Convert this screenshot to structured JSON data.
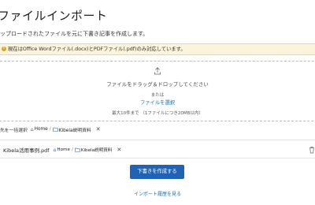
{
  "header": {
    "title": "ファイルインポート",
    "subtitle": "ップロードされたファイルを元に下書き記事を作成します。"
  },
  "notice": {
    "icon": "info-icon",
    "text": "現在はOffice Wordファイル(.docx)とPDFファイル(.pdf)のみ対応しています。"
  },
  "dropzone": {
    "icon": "upload-icon",
    "main_text": "ファイルをドラッグ＆ドロップしてください",
    "or_text": "または",
    "select_label": "ファイルを選択",
    "limit_text": "最大10件まで （1ファイルにつき20MB以内）"
  },
  "destination": {
    "label": "先を一括選択",
    "home_icon": "home-icon",
    "home_label": "Home",
    "folder_icon": "folder-icon",
    "folder_label": "Kibela説明資料",
    "separator": "/",
    "close": "✕"
  },
  "file": {
    "name": "Kibela活用事例.pdf",
    "home_label": "Home",
    "folder_label": "Kibela説明資料",
    "separator": "/",
    "close": "✕",
    "delete_icon": "trash-icon"
  },
  "actions": {
    "create_label": "下書きを作成する",
    "history_label": "インポート履歴を見る"
  },
  "colors": {
    "primary": "#1f63b6",
    "link": "#1a6fb0",
    "notice_bg": "#fbf4dc",
    "notice_border": "#efd88a"
  }
}
